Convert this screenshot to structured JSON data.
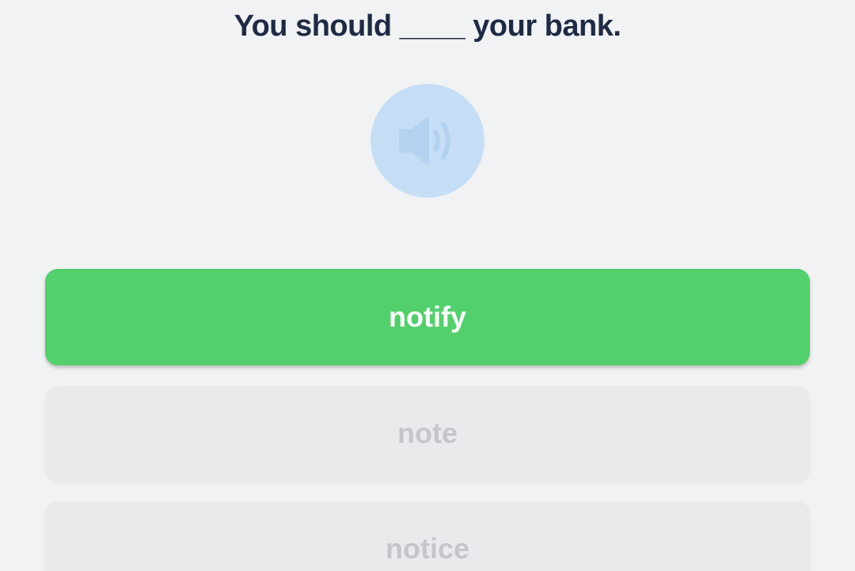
{
  "question": {
    "text": "You should ____ your bank."
  },
  "audio": {
    "icon": "speaker-icon",
    "color": "#c6def5"
  },
  "options": [
    {
      "label": "notify",
      "state": "selected",
      "color": "#52d06b"
    },
    {
      "label": "note",
      "state": "disabled"
    },
    {
      "label": "notice",
      "state": "disabled"
    }
  ]
}
